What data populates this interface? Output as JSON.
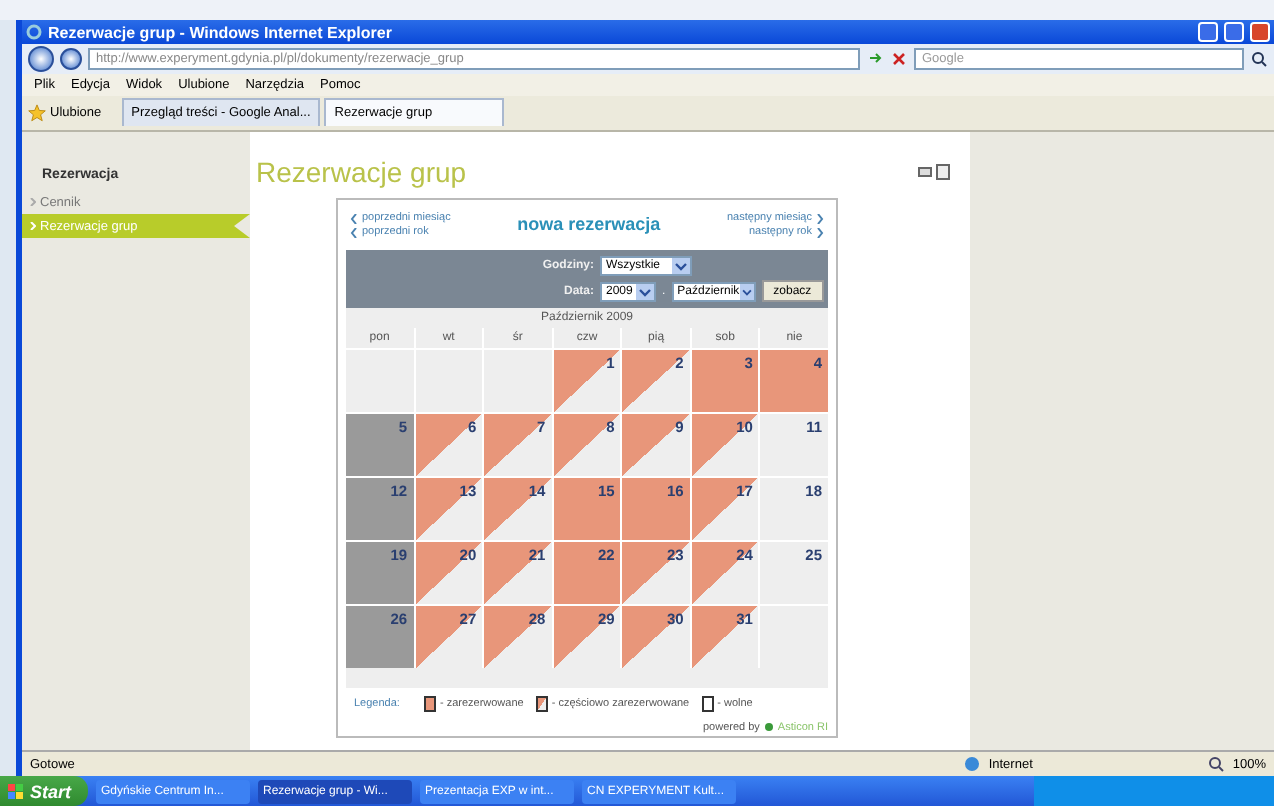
{
  "window": {
    "title": "Rezerwacje grup - Windows Internet Explorer"
  },
  "address_bar": {
    "url": "http://www.experyment.gdynia.pl/pl/dokumenty/rezerwacje_grup",
    "search_placeholder": "Google"
  },
  "menu": [
    "Plik",
    "Edycja",
    "Widok",
    "Ulubione",
    "Narzędzia",
    "Pomoc"
  ],
  "favorites": {
    "label": "Ulubione"
  },
  "tabs": [
    {
      "label": "Przegląd treści - Google Anal...",
      "selected": false
    },
    {
      "label": "Rezerwacje grup",
      "selected": true
    }
  ],
  "sidebar": {
    "heading": "Rezerwacja",
    "items": [
      {
        "label": "Cennik",
        "selected": false
      },
      {
        "label": "Rezerwacje grup",
        "selected": true
      }
    ]
  },
  "page": {
    "title": "Rezerwacje grup"
  },
  "calendar": {
    "prev_month": "poprzedni miesiąc",
    "prev_year": "poprzedni rok",
    "heading": "nowa rezerwacja",
    "next_month": "następny miesiąc",
    "next_year": "następny rok",
    "hours_label": "Godziny:",
    "hours_value": "Wszystkie",
    "date_label": "Data:",
    "year_value": "2009",
    "separator": ".",
    "month_value": "Październik",
    "submit": "zobacz",
    "month_title": "Październik 2009",
    "weekdays": [
      "pon",
      "wt",
      "śr",
      "czw",
      "pią",
      "sob",
      "nie"
    ],
    "weeks": [
      [
        {
          "kind": "empty"
        },
        {
          "kind": "empty"
        },
        {
          "kind": "empty"
        },
        {
          "day": "1",
          "kind": "partial"
        },
        {
          "day": "2",
          "kind": "partial"
        },
        {
          "day": "3",
          "kind": "full"
        },
        {
          "day": "4",
          "kind": "full"
        }
      ],
      [
        {
          "day": "5",
          "kind": "closed"
        },
        {
          "day": "6",
          "kind": "partial"
        },
        {
          "day": "7",
          "kind": "partial"
        },
        {
          "day": "8",
          "kind": "partial"
        },
        {
          "day": "9",
          "kind": "partial"
        },
        {
          "day": "10",
          "kind": "partial"
        },
        {
          "day": "11",
          "kind": "free"
        }
      ],
      [
        {
          "day": "12",
          "kind": "closed"
        },
        {
          "day": "13",
          "kind": "partial"
        },
        {
          "day": "14",
          "kind": "partial"
        },
        {
          "day": "15",
          "kind": "full"
        },
        {
          "day": "16",
          "kind": "full"
        },
        {
          "day": "17",
          "kind": "partial"
        },
        {
          "day": "18",
          "kind": "free"
        }
      ],
      [
        {
          "day": "19",
          "kind": "closed"
        },
        {
          "day": "20",
          "kind": "partial"
        },
        {
          "day": "21",
          "kind": "partial"
        },
        {
          "day": "22",
          "kind": "full"
        },
        {
          "day": "23",
          "kind": "partial"
        },
        {
          "day": "24",
          "kind": "partial"
        },
        {
          "day": "25",
          "kind": "free"
        }
      ],
      [
        {
          "day": "26",
          "kind": "closed"
        },
        {
          "day": "27",
          "kind": "partial"
        },
        {
          "day": "28",
          "kind": "partial"
        },
        {
          "day": "29",
          "kind": "partial"
        },
        {
          "day": "30",
          "kind": "partial"
        },
        {
          "day": "31",
          "kind": "partial"
        },
        {
          "kind": "empty"
        }
      ]
    ],
    "legend": {
      "label": "Legenda:",
      "items": [
        {
          "kind": "full",
          "label": "- zarezerwowane"
        },
        {
          "kind": "partial",
          "label": "- częściowo zarezerwowane"
        },
        {
          "kind": "free",
          "label": "- wolne"
        }
      ]
    },
    "powered_by": "powered by",
    "brand": "Asticon RI"
  },
  "status_bar": {
    "text": "Gotowe",
    "zone": "Internet",
    "zoom": "100%"
  },
  "taskbar": {
    "start": "Start",
    "items": [
      {
        "label": "Gdyńskie Centrum In...",
        "selected": false
      },
      {
        "label": "Rezerwacje grup - Wi...",
        "selected": true
      },
      {
        "label": "Prezentacja EXP w int...",
        "selected": false
      },
      {
        "label": "CN EXPERYMENT Kult...",
        "selected": false
      }
    ]
  }
}
